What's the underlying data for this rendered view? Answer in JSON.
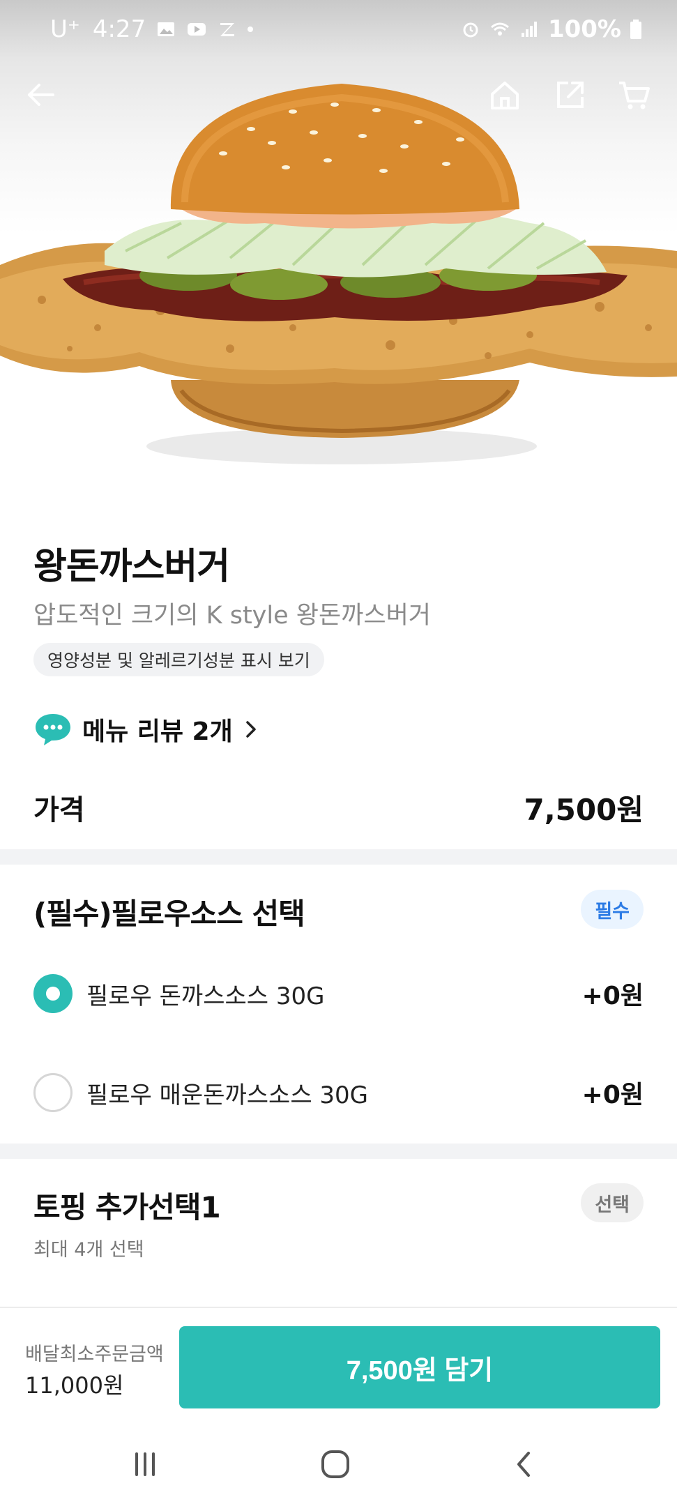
{
  "status_bar": {
    "carrier": "U⁺",
    "time": "4:27",
    "battery": "100%"
  },
  "product": {
    "name": "왕돈까스버거",
    "description": "압도적인 크기의 K style 왕돈까스버거",
    "nutrition_link": "영양성분 및 알레르기성분 표시 보기",
    "review_label": "메뉴 리뷰 2개",
    "price_label": "가격",
    "price": "7,500원"
  },
  "sauce_section": {
    "title": "(필수)필로우소스 선택",
    "badge": "필수",
    "options": [
      {
        "label": "필로우 돈까스소스 30G",
        "price": "+0원",
        "selected": true
      },
      {
        "label": "필로우 매운돈까스소스 30G",
        "price": "+0원",
        "selected": false
      }
    ]
  },
  "topping_section": {
    "title": "토핑 추가선택1",
    "badge": "선택",
    "subtitle": "최대 4개 선택"
  },
  "bottom_bar": {
    "min_order_label": "배달최소주문금액",
    "min_order_value": "11,000원",
    "cart_button": "7,500원 담기"
  },
  "colors": {
    "accent": "#2bbdb4",
    "required_badge_text": "#2c7be5",
    "required_badge_bg": "#eaf4ff"
  },
  "icons": {
    "back": "back-arrow-icon",
    "home": "home-icon",
    "share": "share-icon",
    "cart": "cart-icon",
    "review": "speech-bubble-icon",
    "chevron": "chevron-right-icon"
  }
}
